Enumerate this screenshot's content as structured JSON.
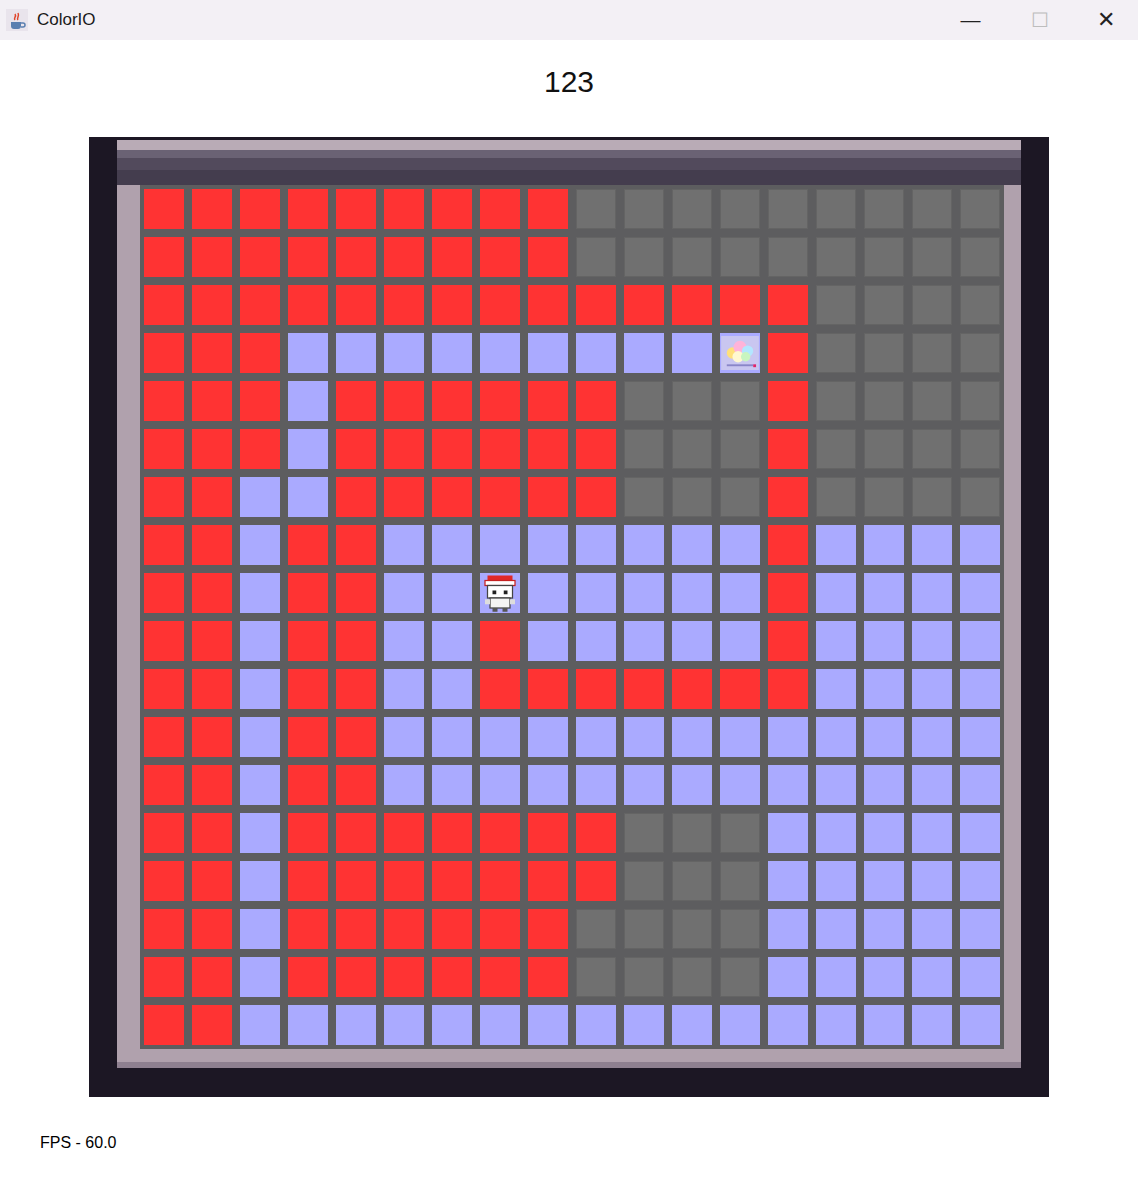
{
  "window": {
    "title": "ColorIO",
    "buttons": [
      {
        "label": "—",
        "disabled": false
      },
      {
        "label": "☐",
        "disabled": true
      },
      {
        "label": "✕",
        "disabled": false
      }
    ]
  },
  "score": "123",
  "board": {
    "player": {
      "row": 8,
      "col": 7
    },
    "item": {
      "row": 3,
      "col": 12
    },
    "rows": [
      [
        "red",
        "red",
        "red",
        "red",
        "red",
        "red",
        "red",
        "red",
        "red",
        "grey",
        "grey",
        "grey",
        "grey",
        "grey",
        "grey",
        "grey",
        "grey",
        "grey"
      ],
      [
        "red",
        "red",
        "red",
        "red",
        "red",
        "red",
        "red",
        "red",
        "red",
        "grey",
        "grey",
        "grey",
        "grey",
        "grey",
        "grey",
        "grey",
        "grey",
        "grey"
      ],
      [
        "red",
        "red",
        "red",
        "red",
        "red",
        "red",
        "red",
        "red",
        "red",
        "red",
        "red",
        "red",
        "red",
        "red",
        "grey",
        "grey",
        "grey",
        "grey"
      ],
      [
        "red",
        "red",
        "red",
        "blue",
        "blue",
        "blue",
        "blue",
        "blue",
        "blue",
        "blue",
        "blue",
        "blue",
        "blue",
        "red",
        "grey",
        "grey",
        "grey",
        "grey"
      ],
      [
        "red",
        "red",
        "red",
        "blue",
        "red",
        "red",
        "red",
        "red",
        "red",
        "red",
        "grey",
        "grey",
        "grey",
        "red",
        "grey",
        "grey",
        "grey",
        "grey"
      ],
      [
        "red",
        "red",
        "red",
        "blue",
        "red",
        "red",
        "red",
        "red",
        "red",
        "red",
        "grey",
        "grey",
        "grey",
        "red",
        "grey",
        "grey",
        "grey",
        "grey"
      ],
      [
        "red",
        "red",
        "blue",
        "blue",
        "red",
        "red",
        "red",
        "red",
        "red",
        "red",
        "grey",
        "grey",
        "grey",
        "red",
        "grey",
        "grey",
        "grey",
        "grey"
      ],
      [
        "red",
        "red",
        "blue",
        "red",
        "red",
        "blue",
        "blue",
        "blue",
        "blue",
        "blue",
        "blue",
        "blue",
        "blue",
        "red",
        "blue",
        "blue",
        "blue",
        "blue"
      ],
      [
        "red",
        "red",
        "blue",
        "red",
        "red",
        "blue",
        "blue",
        "blue",
        "blue",
        "blue",
        "blue",
        "blue",
        "blue",
        "red",
        "blue",
        "blue",
        "blue",
        "blue"
      ],
      [
        "red",
        "red",
        "blue",
        "red",
        "red",
        "blue",
        "blue",
        "red",
        "blue",
        "blue",
        "blue",
        "blue",
        "blue",
        "red",
        "blue",
        "blue",
        "blue",
        "blue"
      ],
      [
        "red",
        "red",
        "blue",
        "red",
        "red",
        "blue",
        "blue",
        "red",
        "red",
        "red",
        "red",
        "red",
        "red",
        "red",
        "blue",
        "blue",
        "blue",
        "blue"
      ],
      [
        "red",
        "red",
        "blue",
        "red",
        "red",
        "blue",
        "blue",
        "blue",
        "blue",
        "blue",
        "blue",
        "blue",
        "blue",
        "blue",
        "blue",
        "blue",
        "blue",
        "blue"
      ],
      [
        "red",
        "red",
        "blue",
        "red",
        "red",
        "blue",
        "blue",
        "blue",
        "blue",
        "blue",
        "blue",
        "blue",
        "blue",
        "blue",
        "blue",
        "blue",
        "blue",
        "blue"
      ],
      [
        "red",
        "red",
        "blue",
        "red",
        "red",
        "red",
        "red",
        "red",
        "red",
        "red",
        "grey",
        "grey",
        "grey",
        "blue",
        "blue",
        "blue",
        "blue",
        "blue"
      ],
      [
        "red",
        "red",
        "blue",
        "red",
        "red",
        "red",
        "red",
        "red",
        "red",
        "red",
        "grey",
        "grey",
        "grey",
        "blue",
        "blue",
        "blue",
        "blue",
        "blue"
      ],
      [
        "red",
        "red",
        "blue",
        "red",
        "red",
        "red",
        "red",
        "red",
        "red",
        "grey",
        "grey",
        "grey",
        "grey",
        "blue",
        "blue",
        "blue",
        "blue",
        "blue"
      ],
      [
        "red",
        "red",
        "blue",
        "red",
        "red",
        "red",
        "red",
        "red",
        "red",
        "grey",
        "grey",
        "grey",
        "grey",
        "blue",
        "blue",
        "blue",
        "blue",
        "blue"
      ],
      [
        "red",
        "red",
        "blue",
        "blue",
        "blue",
        "blue",
        "blue",
        "blue",
        "blue",
        "blue",
        "blue",
        "blue",
        "blue",
        "blue",
        "blue",
        "blue",
        "blue",
        "blue"
      ]
    ]
  },
  "fps": "FPS - 60.0"
}
